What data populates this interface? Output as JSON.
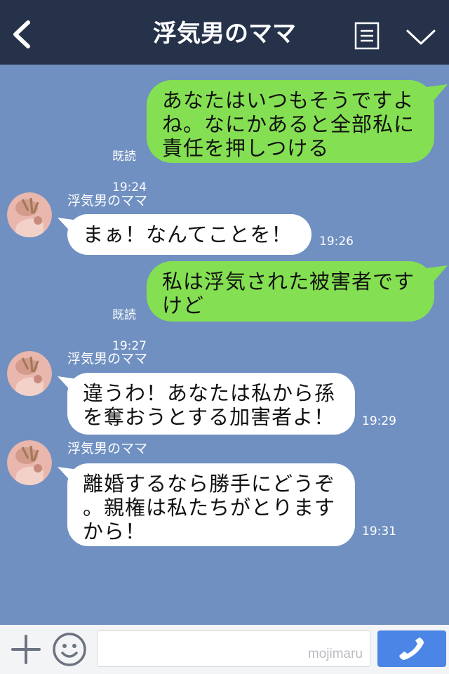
{
  "header": {
    "title": "浮気男のママ",
    "back_icon": "chevron-left-icon",
    "menu_icon": "notes-icon",
    "expand_icon": "chevron-down-icon",
    "background": "#25324a"
  },
  "chat": {
    "background": "#7090c1",
    "messages": [
      {
        "direction": "outgoing",
        "text": "あなたはいつもそうですよ\nね。なにかあると全部私に\n責任を押しつける",
        "read": "既読",
        "time": "19:24"
      },
      {
        "direction": "incoming",
        "sender": "浮気男のママ",
        "text": "まぁ！なんてことを！",
        "time": "19:26"
      },
      {
        "direction": "outgoing",
        "text": "私は浮気された被害者です\nけど",
        "read": "既読",
        "time": "19:27"
      },
      {
        "direction": "incoming",
        "sender": "浮気男のママ",
        "text": "違うわ！あなたは私から孫\nを奪おうとする加害者よ！",
        "time": "19:29"
      },
      {
        "direction": "incoming",
        "sender": "浮気男のママ",
        "text": "離婚するなら勝手にどうぞ\n。親権は私たちがとります\nから！",
        "time": "19:31"
      }
    ],
    "outgoing_bubble_color": "#84e052",
    "incoming_bubble_color": "#ffffff"
  },
  "footer": {
    "add_icon": "plus-icon",
    "sticker_icon": "smiley-icon",
    "input_value": "",
    "watermark": "mojimaru",
    "call_icon": "phone-icon",
    "call_button_color": "#4b86e6"
  }
}
